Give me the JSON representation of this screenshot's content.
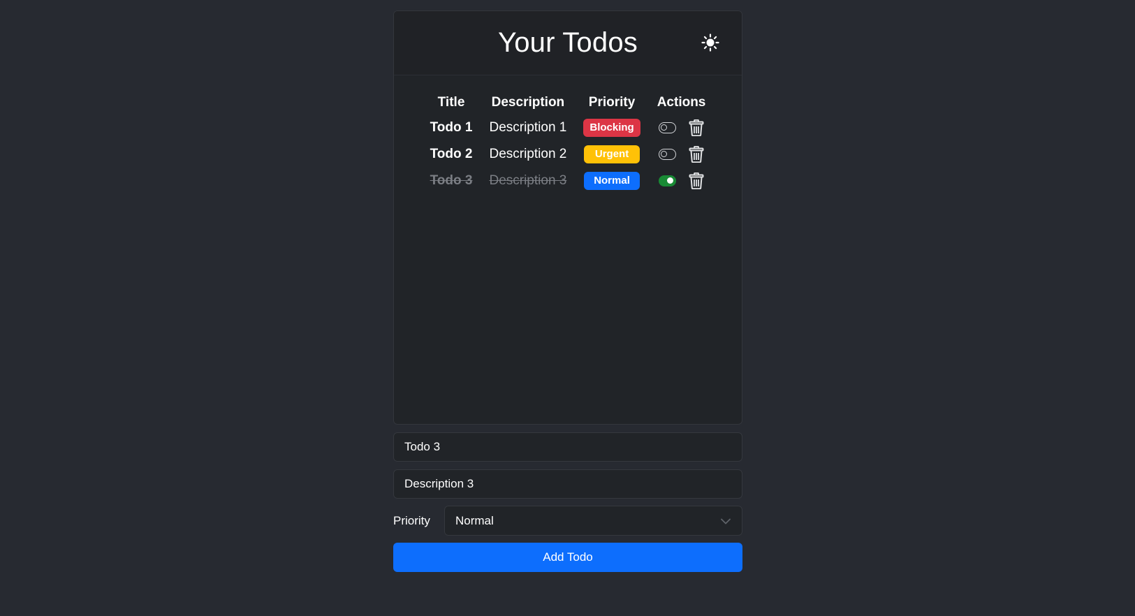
{
  "header": {
    "title": "Your Todos",
    "theme_icon": "sun-icon"
  },
  "table": {
    "columns": [
      "Title",
      "Description",
      "Priority",
      "Actions"
    ],
    "rows": [
      {
        "title": "Todo 1",
        "description": "Description 1",
        "priority": "Blocking",
        "priority_color": "#dc3545",
        "completed": false
      },
      {
        "title": "Todo 2",
        "description": "Description 2",
        "priority": "Urgent",
        "priority_color": "#ffc107",
        "completed": false
      },
      {
        "title": "Todo 3",
        "description": "Description 3",
        "priority": "Normal",
        "priority_color": "#0d6efd",
        "completed": true
      }
    ]
  },
  "form": {
    "title_value": "Todo 3",
    "description_value": "Description 3",
    "priority_label": "Priority",
    "priority_selected": "Normal",
    "submit_label": "Add Todo"
  },
  "colors": {
    "accent": "#0d6efd",
    "done_switch": "#198a35",
    "background": "#272a31"
  }
}
